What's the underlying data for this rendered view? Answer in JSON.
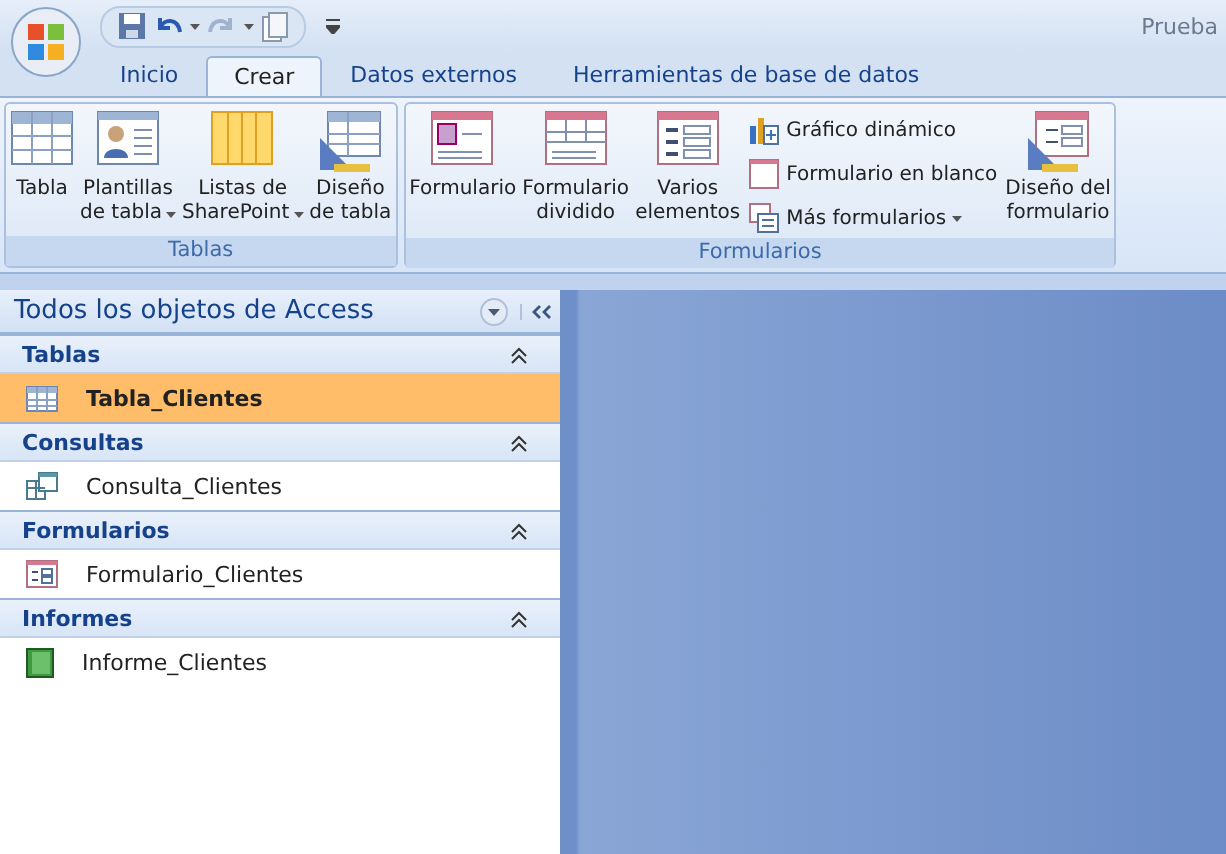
{
  "window": {
    "title": "Prueba"
  },
  "tabs": [
    {
      "label": "Inicio",
      "selected": false
    },
    {
      "label": "Crear",
      "selected": true
    },
    {
      "label": "Datos externos",
      "selected": false
    },
    {
      "label": "Herramientas de base de datos",
      "selected": false
    }
  ],
  "ribbon_groups": [
    {
      "label": "Tablas",
      "buttons": [
        {
          "kind": "large",
          "lines": [
            "Tabla"
          ],
          "dropdown": false
        },
        {
          "kind": "large",
          "lines": [
            "Plantillas",
            "de tabla"
          ],
          "dropdown": true
        },
        {
          "kind": "large",
          "lines": [
            "Listas de",
            "SharePoint"
          ],
          "dropdown": true
        },
        {
          "kind": "large",
          "lines": [
            "Diseño",
            "de tabla"
          ],
          "dropdown": false
        }
      ]
    },
    {
      "label": "Formularios",
      "buttons": [
        {
          "kind": "large",
          "lines": [
            "Formulario"
          ],
          "dropdown": false
        },
        {
          "kind": "large",
          "lines": [
            "Formulario",
            "dividido"
          ],
          "dropdown": false
        },
        {
          "kind": "large",
          "lines": [
            "Varios",
            "elementos"
          ],
          "dropdown": false
        },
        {
          "kind": "stack",
          "items": [
            {
              "label": "Gráfico dinámico",
              "dropdown": false
            },
            {
              "label": "Formulario en blanco",
              "dropdown": false
            },
            {
              "label": "Más formularios",
              "dropdown": true
            }
          ]
        },
        {
          "kind": "large",
          "lines": [
            "Diseño del",
            "formulario"
          ],
          "dropdown": false
        }
      ]
    }
  ],
  "nav_pane": {
    "title": "Todos los objetos de Access",
    "groups": [
      {
        "label": "Tablas",
        "expanded": true,
        "items": [
          {
            "label": "Tabla_Clientes",
            "selected": true
          }
        ]
      },
      {
        "label": "Consultas",
        "expanded": true,
        "items": [
          {
            "label": "Consulta_Clientes",
            "selected": false
          }
        ]
      },
      {
        "label": "Formularios",
        "expanded": true,
        "items": [
          {
            "label": "Formulario_Clientes",
            "selected": false
          }
        ]
      },
      {
        "label": "Informes",
        "expanded": true,
        "items": [
          {
            "label": "Informe_Clientes",
            "selected": false
          }
        ]
      }
    ]
  }
}
